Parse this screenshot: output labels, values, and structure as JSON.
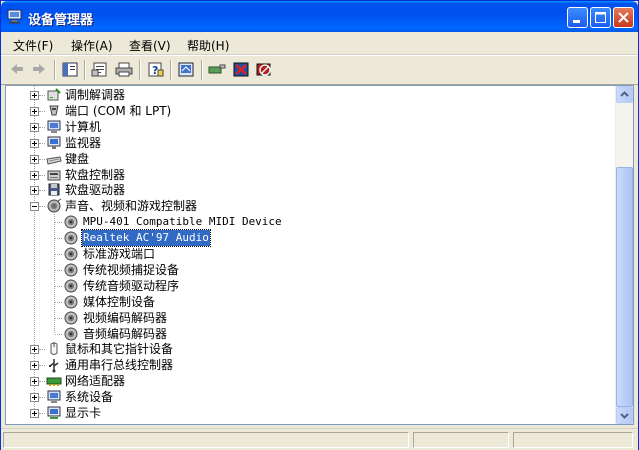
{
  "window": {
    "title": "设备管理器",
    "accent": "#0053ee"
  },
  "menu": [
    {
      "label": "文件(F)"
    },
    {
      "label": "操作(A)"
    },
    {
      "label": "查看(V)"
    },
    {
      "label": "帮助(H)"
    }
  ],
  "toolbar": {
    "items": [
      "back-arrow-icon",
      "forward-arrow-icon",
      "show-hide-console-tree-icon",
      "properties-icon",
      "print-icon",
      "help-icon",
      "scan-hardware-icon",
      "update-driver-icon",
      "uninstall-icon",
      "disable-icon"
    ]
  },
  "tree": {
    "categories_before": [
      {
        "label": "调制解调器",
        "icon": "modem-icon"
      },
      {
        "label": "端口 (COM 和 LPT)",
        "icon": "port-icon"
      },
      {
        "label": "计算机",
        "icon": "computer-icon"
      },
      {
        "label": "监视器",
        "icon": "monitor-icon"
      },
      {
        "label": "键盘",
        "icon": "keyboard-icon"
      },
      {
        "label": "软盘控制器",
        "icon": "floppy-controller-icon"
      },
      {
        "label": "软盘驱动器",
        "icon": "floppy-drive-icon"
      }
    ],
    "expanded": {
      "label": "声音、视频和游戏控制器",
      "icon": "sound-video-game-controller-icon",
      "children": [
        {
          "label": "MPU-401 Compatible MIDI Device",
          "mono": true,
          "selected": false
        },
        {
          "label": "Realtek AC'97 Audio",
          "mono": true,
          "selected": true
        },
        {
          "label": "标准游戏端口",
          "mono": false,
          "selected": false
        },
        {
          "label": "传统视频捕捉设备",
          "mono": false,
          "selected": false
        },
        {
          "label": "传统音频驱动程序",
          "mono": false,
          "selected": false
        },
        {
          "label": "媒体控制设备",
          "mono": false,
          "selected": false
        },
        {
          "label": "视频编码解码器",
          "mono": false,
          "selected": false
        },
        {
          "label": "音频编码解码器",
          "mono": false,
          "selected": false
        }
      ]
    },
    "categories_after": [
      {
        "label": "鼠标和其它指针设备",
        "icon": "mouse-icon"
      },
      {
        "label": "通用串行总线控制器",
        "icon": "usb-icon"
      },
      {
        "label": "网络适配器",
        "icon": "network-adapter-icon"
      },
      {
        "label": "系统设备",
        "icon": "system-device-icon"
      },
      {
        "label": "显示卡",
        "icon": "display-adapter-icon"
      }
    ]
  },
  "scrollbar": {
    "thumb_start_fraction": 0.21,
    "thumb_size_fraction": 0.79
  },
  "colors": {
    "selection": "#316ac5",
    "pane_border": "#7f9db9"
  }
}
